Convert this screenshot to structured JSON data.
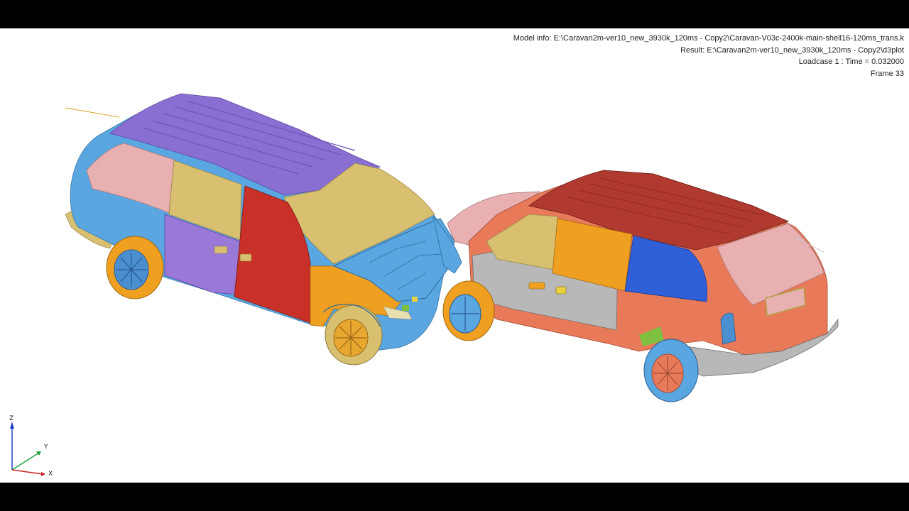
{
  "info": {
    "model_info": "Model info: E:\\Caravan2m-ver10_new_3930k_120ms - Copy2\\Caravan-V03c-2400k-main-shell16-120ms_trans.k",
    "result": "Result: E:\\Caravan2m-ver10_new_3930k_120ms - Copy2\\d3plot",
    "loadcase": "Loadcase 1 : Time = 0.032000",
    "frame": "Frame 33"
  },
  "axes": {
    "z": "Z",
    "y": "Y",
    "x": "X"
  },
  "colors": {
    "background": "#ffffff",
    "frame_bars": "#000000",
    "body_blue": "#5aa6e0",
    "roof_purple": "#8a6fd2",
    "tan": "#d8c070",
    "pink": "#e8b0b0",
    "red": "#c83028",
    "orange": "#f0a020",
    "gray": "#b8b8b8",
    "salmon": "#e87a5a",
    "dark_red": "#b03a30",
    "royal_blue": "#3060d8"
  },
  "icons": [
    "coordinate-triad-icon"
  ]
}
